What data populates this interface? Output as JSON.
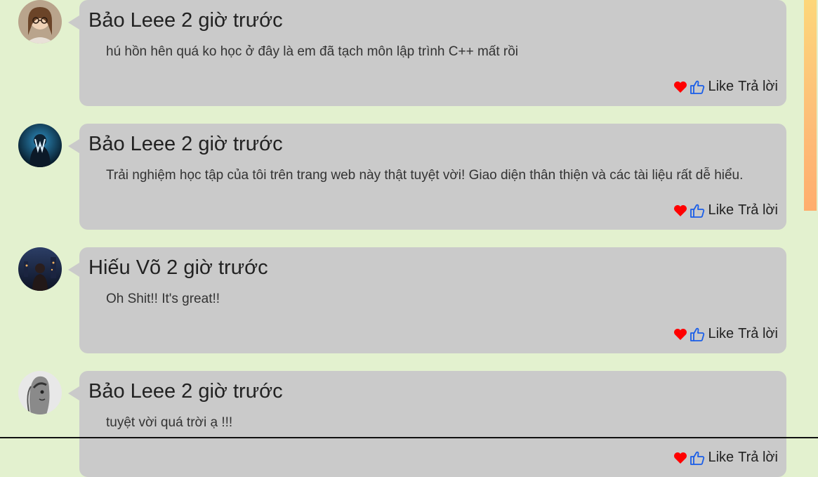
{
  "comments": [
    {
      "author": "Bảo Leee",
      "time": "2 giờ trước",
      "text": "hú hồn hên quá ko học ở đây là em đã tạch môn lập trình C++ mất rồi",
      "like_label": "Like",
      "reply_label": "Trả lời",
      "avatar": "woman-with-glasses"
    },
    {
      "author": "Bảo Leee",
      "time": "2 giờ trước",
      "text": "Trải nghiệm học tập của tôi trên trang web này thật tuyệt vời! Giao diện thân thiện và các tài liệu rất dễ hiểu.",
      "like_label": "Like",
      "reply_label": "Trả lời",
      "avatar": "hooded-figure-logo"
    },
    {
      "author": "Hiếu Võ",
      "time": "2 giờ trước",
      "text": "Oh Shit!! It's great!!",
      "like_label": "Like",
      "reply_label": "Trả lời",
      "avatar": "night-city-figure"
    },
    {
      "author": "Bảo Leee",
      "time": "2 giờ trước",
      "text": "tuyệt vời quá trời ạ !!!",
      "like_label": "Like",
      "reply_label": "Trả lời",
      "avatar": "grayscale-face"
    }
  ],
  "colors": {
    "background": "#e3f1cf",
    "bubble": "#cacaca",
    "heart": "#ff0000",
    "thumb": "#1a5ee8"
  },
  "icons": {
    "heart": "heart-icon",
    "like": "thumbs-up-icon"
  }
}
